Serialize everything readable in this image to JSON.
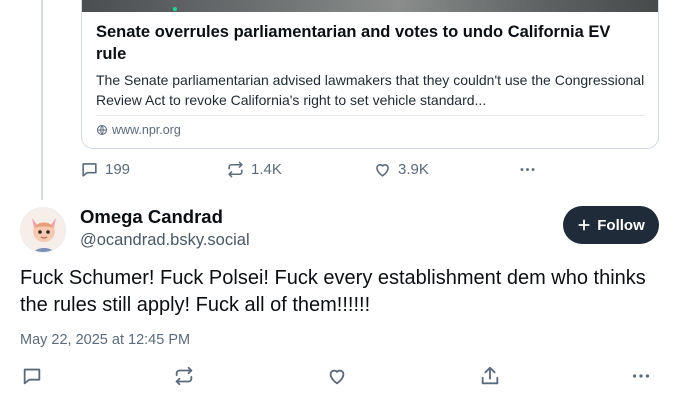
{
  "embed": {
    "title": "Senate overrules parliamentarian and votes to undo California EV rule",
    "description": "The Senate parliamentarian advised lawmakers that they couldn't use the Congressional Review Act to revoke California's right to set vehicle standard...",
    "domain": "www.npr.org"
  },
  "previous_post": {
    "replies": "199",
    "reposts": "1.4K",
    "likes": "3.9K"
  },
  "post": {
    "display_name": "Omega Candrad",
    "handle": "@ocandrad.bsky.social",
    "follow_label": "Follow",
    "text": "Fuck Schumer! Fuck Polsei! Fuck every establishment dem who thinks the rules still apply! Fuck all of them!!!!!!",
    "date": "May 22, 2025 at 12:45 PM"
  },
  "icons": [
    "reply-icon",
    "repost-icon",
    "like-icon",
    "share-icon",
    "more-icon",
    "globe-icon",
    "plus-icon"
  ],
  "colors": {
    "follow_bg": "#1f2b38",
    "muted": "#5b6b7b",
    "border": "#d4dbe2"
  }
}
